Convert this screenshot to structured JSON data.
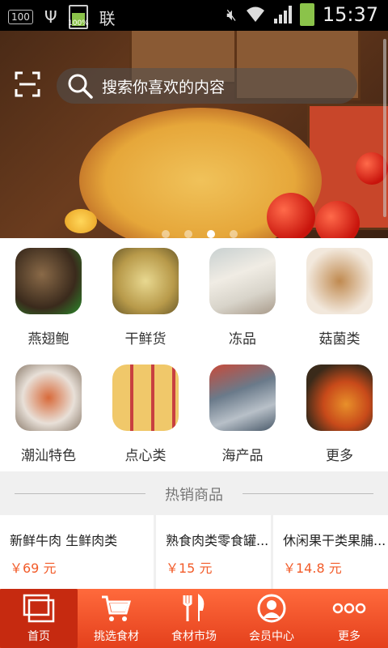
{
  "status_bar": {
    "box_label": "100",
    "battery_percent": "100%",
    "sim_label": "联",
    "time": "15:37"
  },
  "search": {
    "placeholder": "搜索你喜欢的内容"
  },
  "banner": {
    "slide_count": 4,
    "active_slide": 3
  },
  "categories": [
    {
      "label": "燕翅鲍",
      "icon": "abalone-image"
    },
    {
      "label": "干鲜货",
      "icon": "dried-goods-image"
    },
    {
      "label": "冻品",
      "icon": "frozen-goods-image"
    },
    {
      "label": "菇菌类",
      "icon": "mushroom-image"
    },
    {
      "label": "潮汕特色",
      "icon": "chaoshan-platter-image"
    },
    {
      "label": "点心类",
      "icon": "dim-sum-image"
    },
    {
      "label": "海产品",
      "icon": "seafood-image"
    },
    {
      "label": "更多",
      "icon": "spices-image"
    }
  ],
  "hot": {
    "title": "热销商品",
    "products": [
      {
        "name": "新鲜牛肉 生鲜肉类",
        "price": "￥69 元"
      },
      {
        "name": "熟食肉类零食罐...",
        "price": "￥15 元"
      },
      {
        "name": "休闲果干类果脯...",
        "price": "￥14.8 元"
      }
    ]
  },
  "nav": [
    {
      "label": "首页",
      "icon": "home-icon"
    },
    {
      "label": "挑选食材",
      "icon": "cart-icon"
    },
    {
      "label": "食材市场",
      "icon": "fork-knife-icon"
    },
    {
      "label": "会员中心",
      "icon": "user-icon"
    },
    {
      "label": "更多",
      "icon": "more-dots-icon"
    }
  ],
  "colors": {
    "accent": "#e84a22",
    "price": "#f25c2a",
    "nav_active": "#c62a10"
  }
}
